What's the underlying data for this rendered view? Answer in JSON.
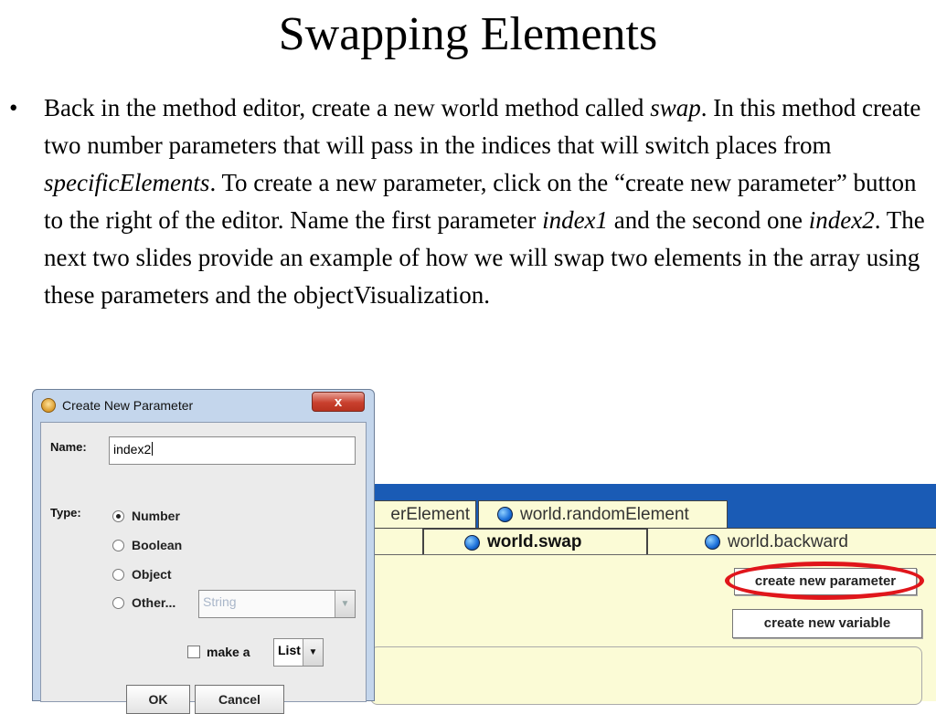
{
  "slide": {
    "title": "Swapping Elements",
    "bullet_symbol": "•",
    "bullet": {
      "t1": "Back in the method editor, create a new world method called ",
      "i1": "swap",
      "t2": ". In this method create two number parameters that will pass in the indices that will switch places from ",
      "i2": "specificElements",
      "t3": ". To create a new parameter, click on the “create new parameter” button to the right of the editor. Name the first parameter ",
      "i3": "index1",
      "t4": " and the second one ",
      "i4": "index2",
      "t5": ". The next two slides provide an example of how we will swap two elements in the array using these parameters and the objectVisualization."
    }
  },
  "editor": {
    "tabs_row1": [
      "erElement",
      "world.randomElement"
    ],
    "tabs_row2": [
      "",
      "world.swap",
      "world.backward"
    ],
    "active_tab": "world.swap",
    "create_parameter_label": "create new parameter",
    "create_variable_label": "create new variable",
    "highlight_color": "#e0161b",
    "header_color": "#1a5bb5",
    "background_color": "#fbfbd6"
  },
  "dialog": {
    "title": "Create New Parameter",
    "close_label": "x",
    "name_label": "Name:",
    "name_value": "index2",
    "type_label": "Type:",
    "type_options": [
      {
        "label": "Number",
        "selected": true
      },
      {
        "label": "Boolean",
        "selected": false
      },
      {
        "label": "Object",
        "selected": false
      },
      {
        "label": "Other...",
        "selected": false
      }
    ],
    "other_type_value": "String",
    "make_a_label": "make a",
    "make_a_checked": false,
    "make_a_value": "List",
    "ok_label": "OK",
    "cancel_label": "Cancel"
  }
}
